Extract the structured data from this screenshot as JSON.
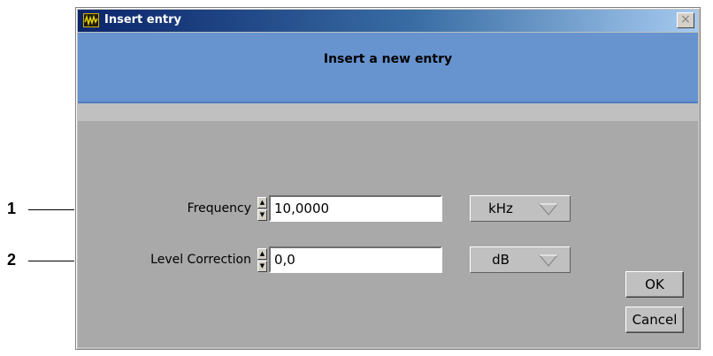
{
  "callouts": [
    "1",
    "2"
  ],
  "window": {
    "title": "Insert entry",
    "close_label": "×"
  },
  "header": {
    "title": "Insert a new entry"
  },
  "form": {
    "frequency": {
      "label": "Frequency",
      "value": "10,0000",
      "unit": "kHz"
    },
    "level_correction": {
      "label": "Level Correction",
      "value": "0,0",
      "unit": "dB"
    }
  },
  "buttons": {
    "ok": "OK",
    "cancel": "Cancel"
  },
  "icons": {
    "app": "waveform-icon",
    "close": "close-icon",
    "spin_up": "triangle-up-icon",
    "spin_down": "triangle-down-icon",
    "dropdown": "triangle-down-outline-icon"
  },
  "colors": {
    "titlebar_start": "#0a246a",
    "header_band": "#6793cf",
    "panel": "#a9a9a9"
  }
}
